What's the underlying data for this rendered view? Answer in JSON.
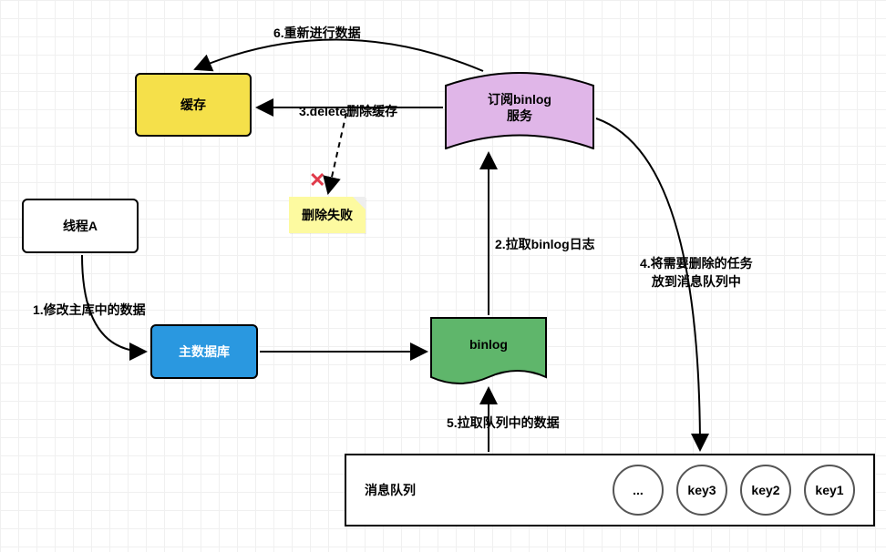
{
  "nodes": {
    "cache": "缓存",
    "thread": "线程A",
    "db": "主数据库",
    "binlog": "binlog",
    "subscribe_l1": "订阅binlog",
    "subscribe_l2": "服务",
    "fail_note": "删除失败"
  },
  "labels": {
    "step1": "1.修改主库中的数据",
    "step2": "2.拉取binlog日志",
    "step3": "3.delete删除缓存",
    "step4_l1": "4.将需要删除的任务",
    "step4_l2": "放到消息队列中",
    "step5": "5.拉取队列中的数据",
    "step6": "6.重新进行数据"
  },
  "queue": {
    "title": "消息队列",
    "slots": [
      "...",
      "key3",
      "key2",
      "key1"
    ]
  },
  "cross": "✕"
}
